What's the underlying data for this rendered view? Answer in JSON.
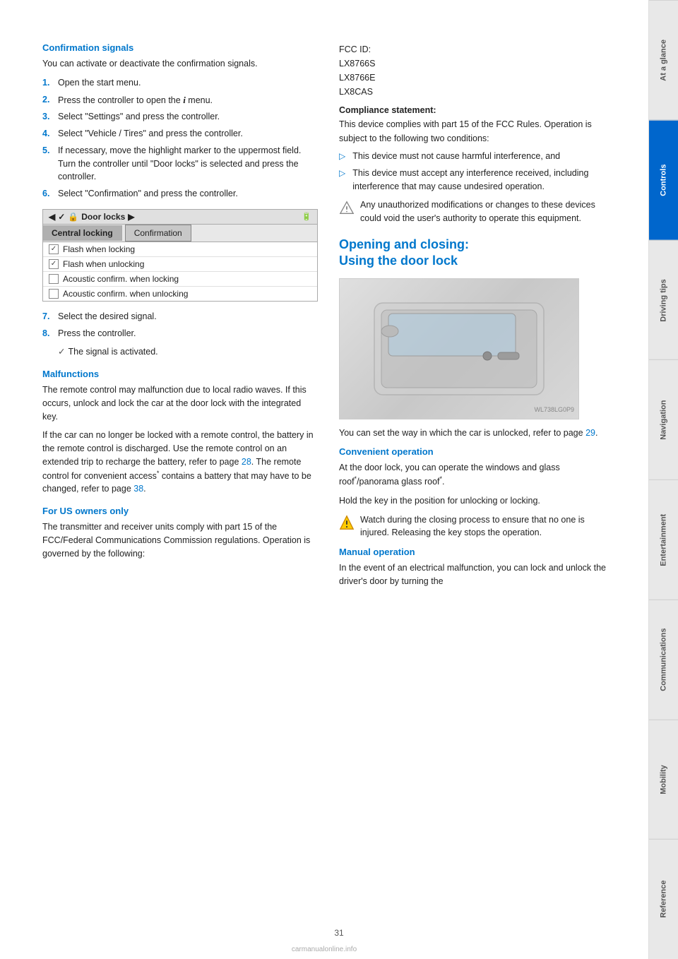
{
  "page": {
    "number": "31",
    "watermark": "carmanualonline.info"
  },
  "sidebar": {
    "tabs": [
      {
        "label": "At a glance",
        "active": false
      },
      {
        "label": "Controls",
        "active": true
      },
      {
        "label": "Driving tips",
        "active": false
      },
      {
        "label": "Navigation",
        "active": false
      },
      {
        "label": "Entertainment",
        "active": false
      },
      {
        "label": "Communications",
        "active": false
      },
      {
        "label": "Mobility",
        "active": false
      },
      {
        "label": "Reference",
        "active": false
      }
    ]
  },
  "left_column": {
    "confirmation_signals": {
      "title": "Confirmation signals",
      "intro": "You can activate or deactivate the confirmation signals.",
      "steps": [
        {
          "num": "1.",
          "text": "Open the start menu."
        },
        {
          "num": "2.",
          "text": "Press the controller to open the"
        },
        {
          "num": "2.",
          "text_suffix": "menu.",
          "has_icon": true
        },
        {
          "num": "3.",
          "text": "Select \"Settings\" and press the controller."
        },
        {
          "num": "4.",
          "text": "Select \"Vehicle / Tires\" and press the controller."
        },
        {
          "num": "5.",
          "text": "If necessary, move the highlight marker to the uppermost field. Turn the controller until \"Door locks\" is selected and press the controller."
        },
        {
          "num": "6.",
          "text": "Select \"Confirmation\" and press the controller."
        }
      ],
      "door_locks_box": {
        "header": "Door locks",
        "tab1": "Central locking",
        "tab2": "Confirmation",
        "rows": [
          {
            "checked": true,
            "label": "Flash when locking"
          },
          {
            "checked": true,
            "label": "Flash when unlocking"
          },
          {
            "checked": false,
            "label": "Acoustic confirm. when locking"
          },
          {
            "checked": false,
            "label": "Acoustic confirm. when unlocking"
          }
        ]
      },
      "steps_after": [
        {
          "num": "7.",
          "text": "Select the desired signal."
        },
        {
          "num": "8.",
          "text": "Press the controller."
        }
      ],
      "activated_text": "The signal is activated."
    },
    "malfunctions": {
      "title": "Malfunctions",
      "para1": "The remote control may malfunction due to local radio waves. If this occurs, unlock and lock the car at the door lock with the integrated key.",
      "para2": "If the car can no longer be locked with a remote control, the battery in the remote control is discharged. Use the remote control on an extended trip to recharge the battery, refer to page",
      "para2_link": "28",
      "para2_suffix": ". The remote control for convenient access",
      "para2_star": "*",
      "para2_end": " contains a battery that may have to be changed, refer to page",
      "para2_link2": "38",
      "para2_end2": "."
    },
    "for_us_owners": {
      "title": "For US owners only",
      "para1": "The transmitter and receiver units comply with part 15 of the FCC/Federal Communications Commission regulations. Operation is governed by the following:"
    }
  },
  "right_column": {
    "fcc_block": {
      "fcc_id_label": "FCC ID:",
      "models": [
        "LX8766S",
        "LX8766E",
        "LX8CAS"
      ],
      "compliance_label": "Compliance statement:",
      "compliance_text": "This device complies with part 15 of the FCC Rules. Operation is subject to the following two conditions:",
      "bullets": [
        "This device must not cause harmful interference, and",
        "This device must accept any interference received, including interference that may cause undesired operation."
      ],
      "warning_text": "Any unauthorized modifications or changes to these devices could void the user's authority to operate this equipment."
    },
    "opening_closing": {
      "title_line1": "Opening and closing:",
      "title_line2": "Using the door lock",
      "image_alt": "Door lock illustration",
      "caption": "WL738LG0P9",
      "body_text": "You can set the way in which the car is unlocked, refer to page",
      "body_link": "29",
      "body_suffix": "."
    },
    "convenient_operation": {
      "title": "Convenient operation",
      "para1_prefix": "At the door lock, you can operate the windows and glass roof",
      "para1_star": "*",
      "para1_mid": "/panorama glass roof",
      "para1_star2": "*",
      "para1_suffix": ".",
      "para2": "Hold the key in the position for unlocking or locking.",
      "warning": "Watch during the closing process to ensure that no one is injured. Releasing the key stops the operation."
    },
    "manual_operation": {
      "title": "Manual operation",
      "para1": "In the event of an electrical malfunction, you can lock and unlock the driver's door by turning the"
    }
  }
}
